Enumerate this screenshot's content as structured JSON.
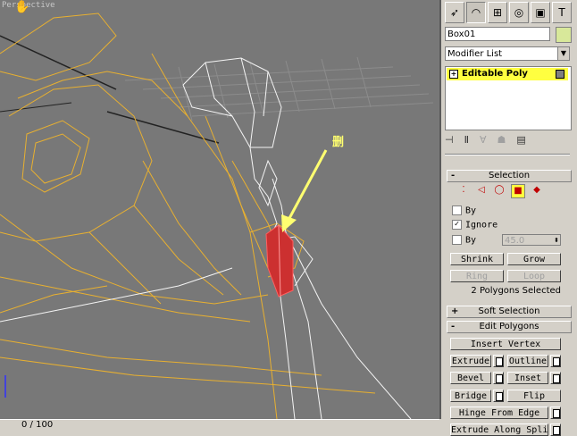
{
  "viewport": {
    "label": "Perspective",
    "annotation_text": "删"
  },
  "timebar": {
    "frame": "0 / 100"
  },
  "panel": {
    "object_name": "Box01",
    "modifier_list": "Modifier List",
    "stack_item": "Editable Poly",
    "selection": {
      "title": "Selection",
      "by_label": "By",
      "ignore_label": "Ignore",
      "by2_label": "By",
      "angle_value": "45.0",
      "shrink": "Shrink",
      "grow": "Grow",
      "ring": "Ring",
      "loop": "Loop",
      "status": "2 Polygons Selected"
    },
    "soft_selection": {
      "title": "Soft Selection",
      "sign": "+"
    },
    "edit_polygons": {
      "title": "Edit Polygons",
      "sign": "-",
      "insert_vertex": "Insert Vertex",
      "extrude": "Extrude",
      "outline": "Outline",
      "bevel": "Bevel",
      "inset": "Inset",
      "bridge": "Bridge",
      "flip": "Flip",
      "hinge": "Hinge From Edge",
      "extrude_spline": "Extrude Along Spline"
    }
  }
}
